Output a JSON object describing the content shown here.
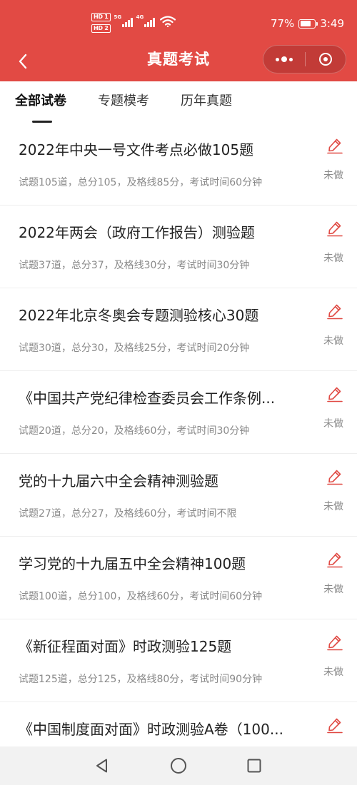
{
  "status_bar": {
    "hd1": "HD 1",
    "hd2": "HD 2",
    "net1": "5G",
    "net2": "4G",
    "battery_percent": "77%",
    "battery_level": 0.77,
    "time": "3:49"
  },
  "nav": {
    "title": "真题考试",
    "back_icon": "chevron-left-icon",
    "more_icon": "more-dots-icon",
    "close_icon": "target-close-icon"
  },
  "tabs": [
    {
      "label": "全部试卷",
      "active": true
    },
    {
      "label": "专题模考",
      "active": false
    },
    {
      "label": "历年真题",
      "active": false
    }
  ],
  "exams": [
    {
      "title": "2022年中央一号文件考点必做105题",
      "meta": "试题105道，总分105，及格线85分，考试时间60分钟",
      "status": "未做"
    },
    {
      "title": "2022年两会（政府工作报告）测验题",
      "meta": "试题37道，总分37，及格线30分，考试时间30分钟",
      "status": "未做"
    },
    {
      "title": "2022年北京冬奥会专题测验核心30题",
      "meta": "试题30道，总分30，及格线25分，考试时间20分钟",
      "status": "未做"
    },
    {
      "title": "《中国共产党纪律检查委员会工作条例...",
      "meta": "试题20道，总分20，及格线60分，考试时间30分钟",
      "status": "未做"
    },
    {
      "title": "党的十九届六中全会精神测验题",
      "meta": "试题27道，总分27，及格线60分，考试时间不限",
      "status": "未做"
    },
    {
      "title": "学习党的十九届五中全会精神100题",
      "meta": "试题100道，总分100，及格线60分，考试时间60分钟",
      "status": "未做"
    },
    {
      "title": "《新征程面对面》时政测验125题",
      "meta": "试题125道，总分125，及格线80分，考试时间90分钟",
      "status": "未做"
    },
    {
      "title": "《中国制度面对面》时政测验A卷（100...",
      "meta": "",
      "status": ""
    }
  ],
  "colors": {
    "header_red": "#e24a44",
    "edit_icon_red": "#e04a44",
    "meta_gray": "#8a8a8a"
  },
  "system_nav": {
    "back_icon": "triangle-back-icon",
    "home_icon": "circle-home-icon",
    "recent_icon": "square-recent-icon"
  }
}
